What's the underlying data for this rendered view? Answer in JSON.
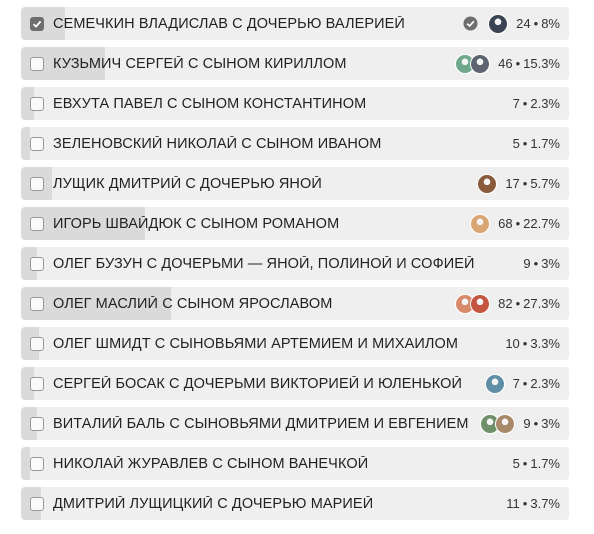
{
  "poll": {
    "options": [
      {
        "label": "СЕМЕЧКИН ВЛАДИСЛАВ С ДОЧЕРЬЮ ВАЛЕРИЕЙ",
        "count": "24",
        "percent": "8%",
        "share": 0.08,
        "checked": true,
        "voted": true,
        "avatars": [
          "#3b4452"
        ]
      },
      {
        "label": "КУЗЬМИЧ СЕРГЕЙ С СЫНОМ КИРИЛЛОМ",
        "count": "46",
        "percent": "15.3%",
        "share": 0.153,
        "checked": false,
        "voted": false,
        "avatars": [
          "#6fa88d",
          "#5d6470"
        ]
      },
      {
        "label": "ЕВХУТА ПАВЕЛ С СЫНОМ КОНСТАНТИНОМ",
        "count": "7",
        "percent": "2.3%",
        "share": 0.023,
        "checked": false,
        "voted": false,
        "avatars": []
      },
      {
        "label": "ЗЕЛЕНОВСКИЙ НИКОЛАЙ С СЫНОМ ИВАНОМ",
        "count": "5",
        "percent": "1.7%",
        "share": 0.017,
        "checked": false,
        "voted": false,
        "avatars": []
      },
      {
        "label": "ЛУЩИК ДМИТРИЙ С ДОЧЕРЬЮ ЯНОЙ",
        "count": "17",
        "percent": "5.7%",
        "share": 0.057,
        "checked": false,
        "voted": false,
        "avatars": [
          "#8a5a3c"
        ]
      },
      {
        "label": "ИГОРЬ ШВАЙДЮК С СЫНОМ РОМАНОМ",
        "count": "68",
        "percent": "22.7%",
        "share": 0.227,
        "checked": false,
        "voted": false,
        "avatars": [
          "#d9a574"
        ]
      },
      {
        "label": "ОЛЕГ БУЗУН С ДОЧЕРЬМИ — ЯНОЙ, ПОЛИНОЙ И СОФИЕЙ",
        "count": "9",
        "percent": "3%",
        "share": 0.03,
        "checked": false,
        "voted": false,
        "avatars": []
      },
      {
        "label": "ОЛЕГ МАСЛИЙ С СЫНОМ ЯРОСЛАВОМ",
        "count": "82",
        "percent": "27.3%",
        "share": 0.273,
        "checked": false,
        "voted": false,
        "avatars": [
          "#d98a6a",
          "#c4553f"
        ]
      },
      {
        "label": "ОЛЕГ ШМИДТ С СЫНОВЬЯМИ АРТЕМИЕМ И МИХАИЛОМ",
        "count": "10",
        "percent": "3.3%",
        "share": 0.033,
        "checked": false,
        "voted": false,
        "avatars": []
      },
      {
        "label": "СЕРГЕЙ БОСАК С ДОЧЕРЬМИ ВИКТОРИЕЙ И ЮЛЕНЬКОЙ",
        "count": "7",
        "percent": "2.3%",
        "share": 0.023,
        "checked": false,
        "voted": false,
        "avatars": [
          "#5f8fa6"
        ]
      },
      {
        "label": "ВИТАЛИЙ БАЛЬ С СЫНОВЬЯМИ ДМИТРИЕМ И ЕВГЕНИЕМ",
        "count": "9",
        "percent": "3%",
        "share": 0.03,
        "checked": false,
        "voted": false,
        "avatars": [
          "#6f8f6a",
          "#a8896a"
        ]
      },
      {
        "label": "НИКОЛАЙ ЖУРАВЛЕВ С СЫНОМ ВАНЕЧКОЙ",
        "count": "5",
        "percent": "1.7%",
        "share": 0.017,
        "checked": false,
        "voted": false,
        "avatars": []
      },
      {
        "label": "ДМИТРИЙ ЛУЩИЦКИЙ С ДОЧЕРЬЮ МАРИЕЙ",
        "count": "11",
        "percent": "3.7%",
        "share": 0.037,
        "checked": false,
        "voted": false,
        "avatars": []
      }
    ]
  },
  "colors": {
    "option_bg": "#efefef",
    "option_fill": "#dadada",
    "checkbox_checked": "#6e6e6e",
    "voted_icon": "#6e6e6e"
  },
  "icons": {
    "checkbox": "checkbox-icon",
    "check": "check-icon",
    "voted": "voted-check-circle-icon",
    "avatar": "avatar"
  }
}
